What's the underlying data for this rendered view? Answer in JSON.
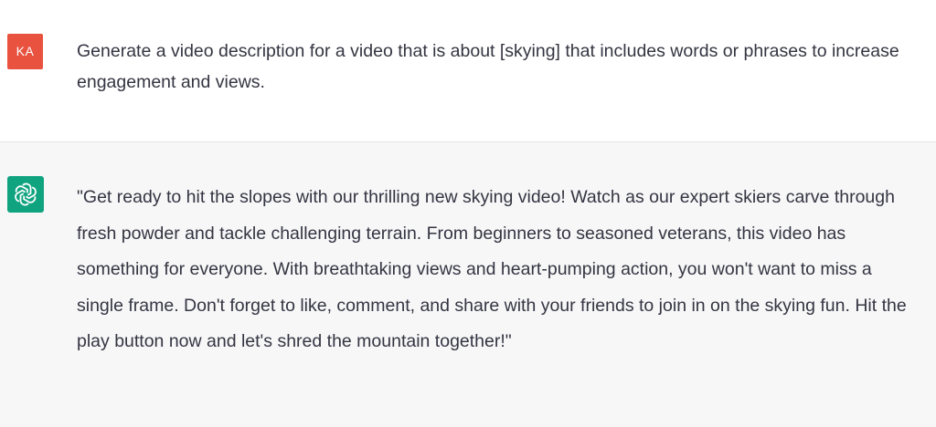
{
  "conversation": {
    "user": {
      "avatar_initials": "KA",
      "avatar_color": "#e8523f",
      "message": "Generate a video description for a video that is about [skying] that includes words or phrases to increase engagement and views."
    },
    "assistant": {
      "avatar_icon": "openai-logo-icon",
      "avatar_color": "#10a37f",
      "message": "\"Get ready to hit the slopes with our thrilling new skying video! Watch as our expert skiers carve through fresh powder and tackle challenging terrain. From beginners to seasoned veterans, this video has something for everyone. With breathtaking views and heart-pumping action, you won't want to miss a single frame. Don't forget to like, comment, and share with your friends to join in on the skying fun. Hit the play button now and let's shred the mountain together!\""
    }
  }
}
